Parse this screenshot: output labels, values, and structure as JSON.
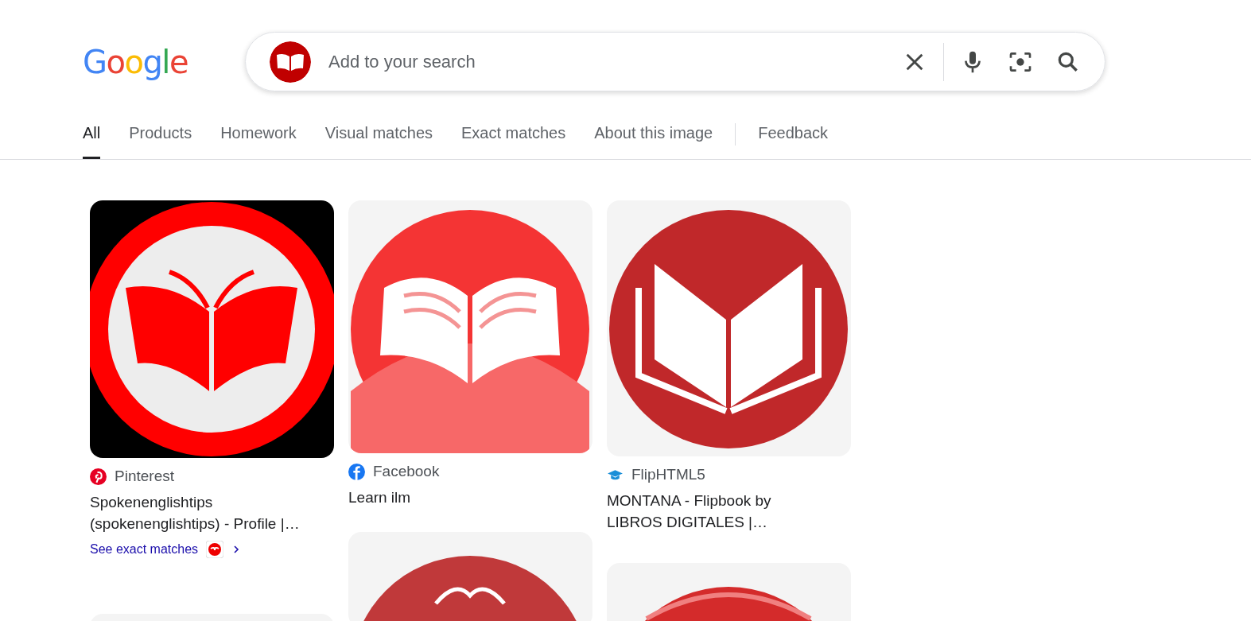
{
  "logo": "Google",
  "search": {
    "placeholder": "Add to your search"
  },
  "tabs": [
    {
      "label": "All",
      "selected": true
    },
    {
      "label": "Products",
      "selected": false
    },
    {
      "label": "Homework",
      "selected": false
    },
    {
      "label": "Visual matches",
      "selected": false
    },
    {
      "label": "Exact matches",
      "selected": false
    },
    {
      "label": "About this image",
      "selected": false
    }
  ],
  "feedback": "Feedback",
  "columns": [
    {
      "items": [
        {
          "kind": "result",
          "source": "Pinterest",
          "title": "Spokenenglishtips (spokenenglishtips) - Profile |…",
          "link": "See exact matches"
        },
        {
          "kind": "picture"
        }
      ]
    },
    {
      "items": [
        {
          "kind": "result",
          "source": "Facebook",
          "title": "Learn ilm"
        },
        {
          "kind": "picture"
        }
      ]
    },
    {
      "items": [
        {
          "kind": "result",
          "source": "FlipHTML5",
          "title": "MONTANA - Flipbook by LIBROS DIGITALES |…"
        },
        {
          "kind": "picture"
        }
      ]
    }
  ]
}
